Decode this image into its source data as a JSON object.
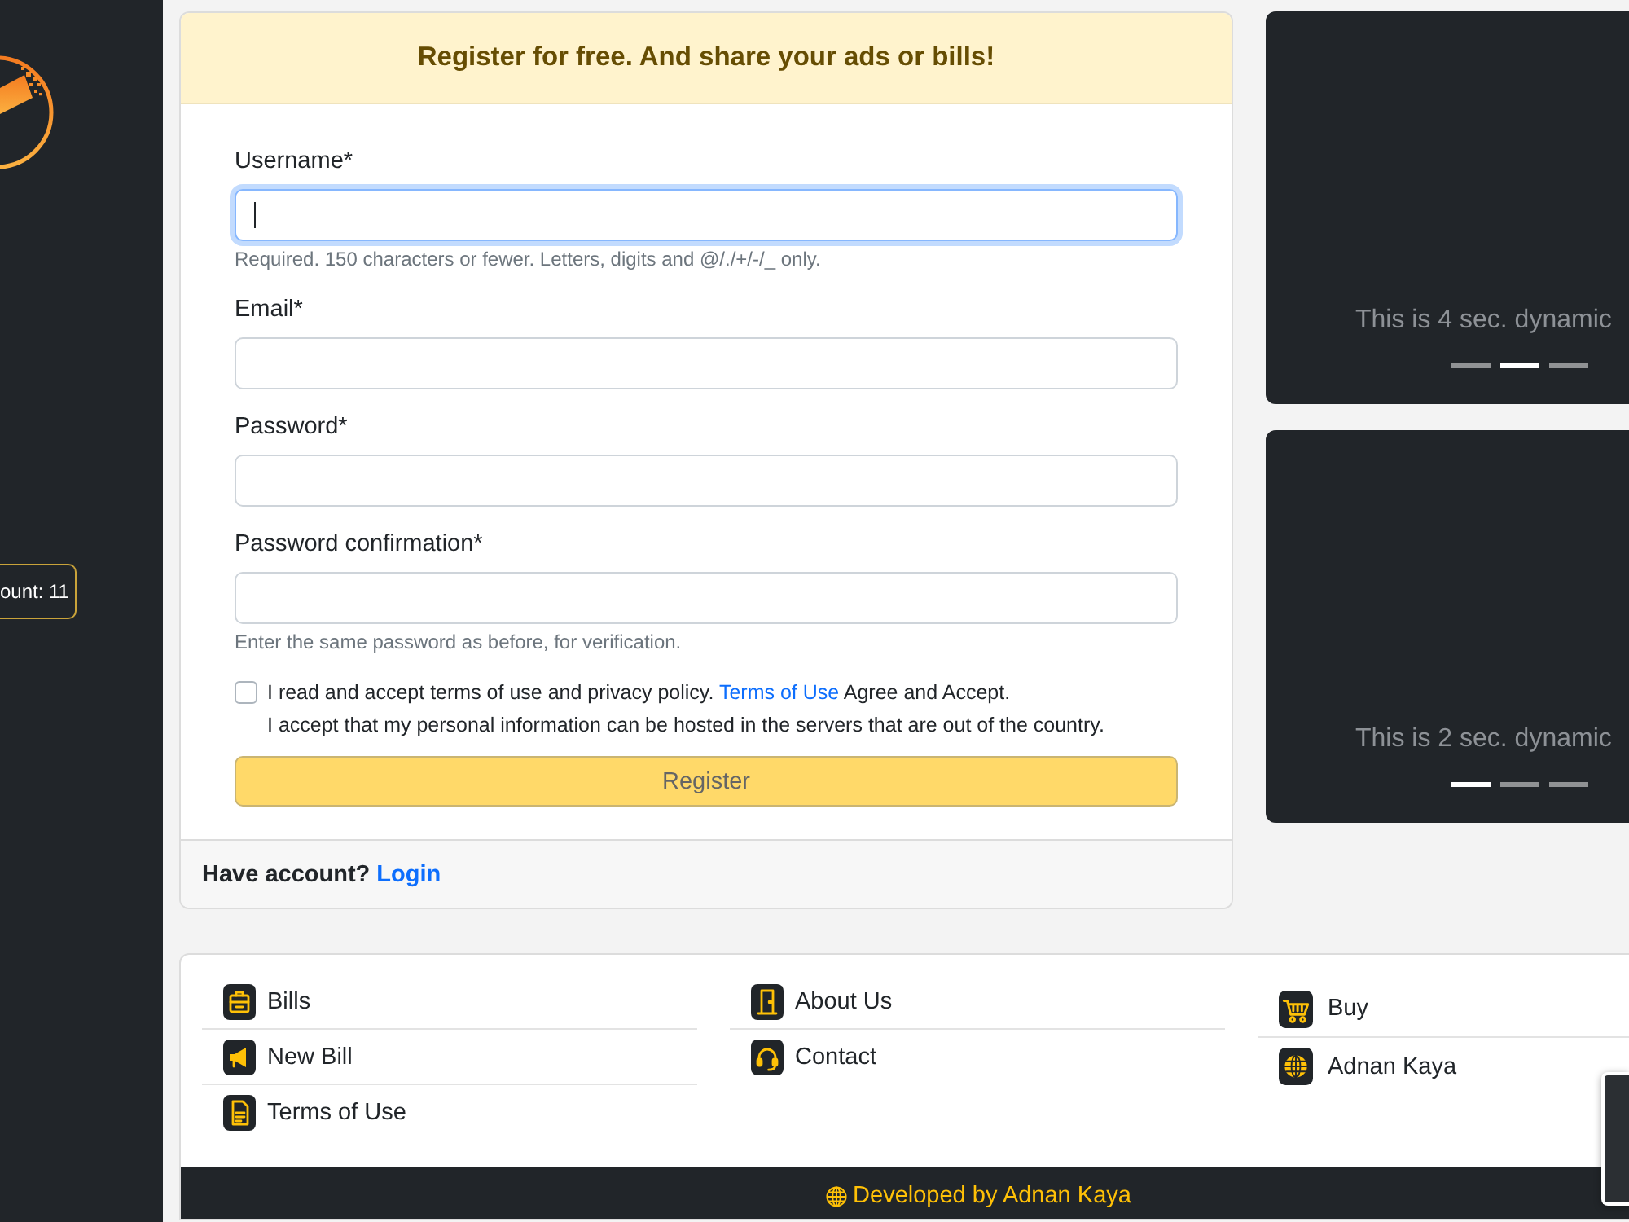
{
  "sidebar": {
    "count_badge": "ount: 11"
  },
  "register_card": {
    "title": "Register for free. And share your ads or bills!",
    "fields": [
      {
        "label": "Username*",
        "focused": true,
        "help": "Required. 150 characters or fewer. Letters, digits and @/./+/-/_ only."
      },
      {
        "label": "Email*",
        "focused": false
      },
      {
        "label": "Password*",
        "focused": false
      },
      {
        "label": "Password confirmation*",
        "focused": false,
        "help": "Enter the same password as before, for verification."
      }
    ],
    "consent": {
      "checked": false,
      "text_before": "I read and accept terms of use and privacy policy.",
      "link": "Terms of Use",
      "text_after": "Agree and Accept.",
      "note": "I accept that my personal information can be hosted in the servers that are out of the country."
    },
    "submit": {
      "label": "Register",
      "disabled": true
    },
    "footer": {
      "text": "Have account?",
      "link": "Login"
    }
  },
  "carousels": [
    {
      "caption": "This is 4 sec. dynamic",
      "indicators": [
        {
          "selected": false
        },
        {
          "selected": true
        },
        {
          "selected": false
        }
      ]
    },
    {
      "caption": "This is 2 sec. dynamic",
      "indicators": [
        {
          "selected": true
        },
        {
          "selected": false
        },
        {
          "selected": false
        }
      ]
    }
  ],
  "footer_links": {
    "columns": [
      {
        "links": [
          {
            "label": "Bills"
          },
          {
            "label": "New Bill"
          },
          {
            "label": "Terms of Use"
          }
        ]
      },
      {
        "links": [
          {
            "label": "About Us"
          },
          {
            "label": "Contact"
          }
        ]
      },
      {
        "links": [
          {
            "label": "Buy"
          },
          {
            "label": "Adnan Kaya"
          }
        ]
      }
    ]
  },
  "footer_bar": {
    "credit": "Developed by Adnan Kaya"
  }
}
